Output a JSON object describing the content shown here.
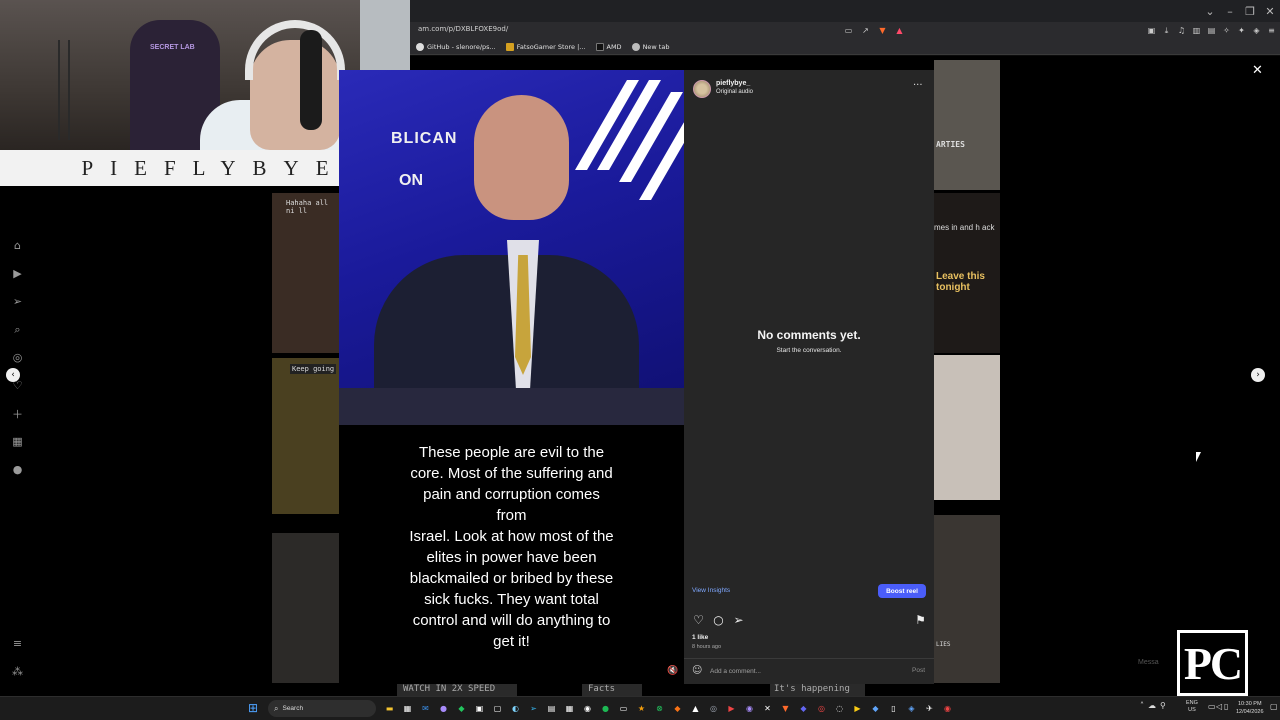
{
  "browser": {
    "url": "am.com/p/DXBLFOXE9od/",
    "bookmarks": [
      {
        "label": "GitHub - slenore/ps..."
      },
      {
        "label": "FatsoGamer Store |..."
      },
      {
        "label": "AMD"
      },
      {
        "label": "New tab"
      }
    ]
  },
  "webcam": {
    "chair_logo": "SECRET LAB",
    "name_banner": "PIEFLYBYE"
  },
  "reel": {
    "backdrop_text_1": "BLICAN",
    "backdrop_text_2": "ON",
    "caption_lines": [
      "These people are evil to the",
      "core. Most of the suffering and",
      "pain and corruption comes",
      "from",
      "Israel. Look at how most of the",
      "elites in power have been",
      "blackmailed or bribed by these",
      "sick fucks. They want total",
      "control and will do anything to",
      "get it!"
    ]
  },
  "panel": {
    "username": "pieflybye_",
    "audio": "Original audio",
    "empty_title": "No comments yet.",
    "empty_subtitle": "Start the conversation.",
    "view_insights": "View Insights",
    "boost_label": "Boost reel",
    "likes": "1 like",
    "time_ago": "8 hours ago",
    "comment_placeholder": "Add a comment...",
    "post_label": "Post"
  },
  "feed_tiles": [
    {
      "text": "Hahaha all ni ll"
    },
    {
      "text": "Keep going"
    },
    {
      "text": "Leave this tonight"
    },
    {
      "text": "ARTIES"
    },
    {
      "text": "mes in and h ack"
    },
    {
      "text": "WATCH IN 2X SPEED"
    },
    {
      "text": "Facts"
    },
    {
      "text": "It's happening"
    },
    {
      "text": "LIES"
    }
  ],
  "watermark": {
    "text": "PC",
    "message_chip": "Messa"
  },
  "taskbar": {
    "search_label": "Search",
    "lang_line1": "ENG",
    "lang_line2": "US",
    "time": "10:30 PM",
    "date": "12/04/2026"
  },
  "colors": {
    "accent": "#4a5df9",
    "link": "#7fa8ff",
    "panel_bg": "#262626"
  }
}
